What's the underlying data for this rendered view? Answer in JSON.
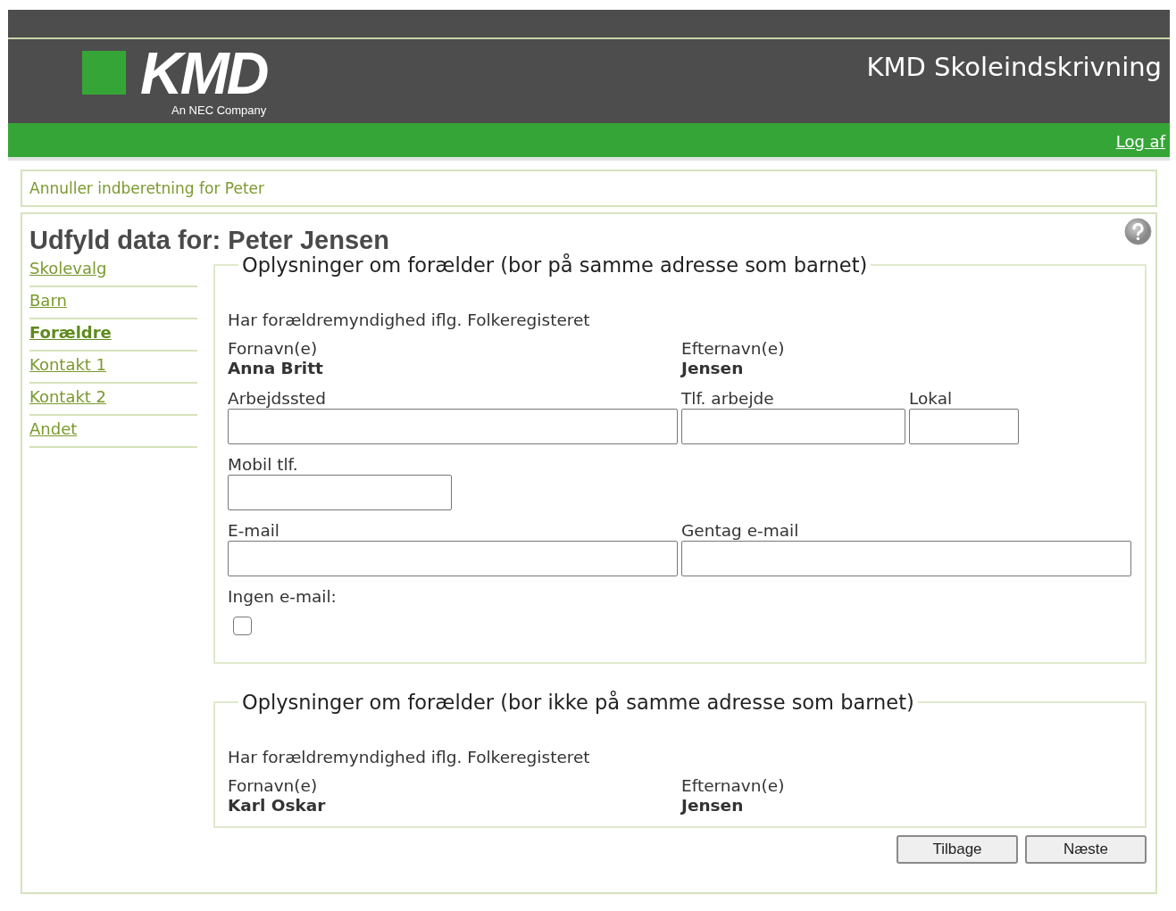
{
  "header": {
    "logo": {
      "wordmark": "KMD",
      "tagline": "An NEC Company"
    },
    "app_title": "KMD Skoleindskrivning",
    "logout_link": "Log af"
  },
  "cancel_link": "Annuller indberetning for Peter",
  "heading": "Udfyld data for: Peter Jensen",
  "nav": [
    {
      "label": "Skolevalg",
      "selected": false
    },
    {
      "label": "Barn",
      "selected": false
    },
    {
      "label": "Forældre",
      "selected": true
    },
    {
      "label": "Kontakt 1",
      "selected": false
    },
    {
      "label": "Kontakt 2",
      "selected": false
    },
    {
      "label": "Andet",
      "selected": false
    }
  ],
  "sections": [
    {
      "legend": "Oplysninger om forælder (bor på samme adresse som barnet)",
      "note": "Har forældremyndighed iflg. Folkeregisteret",
      "names": [
        {
          "label": "Fornavn(e)",
          "value": "Anna Britt"
        },
        {
          "label": "Efternavn(e)",
          "value": "Jensen"
        }
      ],
      "field_rows": [
        [
          {
            "label": "Arbejdssted",
            "kind": "wide"
          },
          {
            "label": "Tlf. arbejde",
            "kind": "medium"
          },
          {
            "label": "Lokal",
            "kind": "small"
          }
        ],
        [
          {
            "label": "Mobil tlf.",
            "kind": "medium"
          }
        ],
        [
          {
            "label": "E-mail",
            "kind": "wide"
          },
          {
            "label": "Gentag e-mail",
            "kind": "wide"
          }
        ]
      ],
      "checkbox": {
        "label": "Ingen e-mail:",
        "checked": false
      }
    },
    {
      "legend": "Oplysninger om forælder (bor ikke på samme adresse som barnet)",
      "note": "Har forældremyndighed iflg. Folkeregisteret",
      "names": [
        {
          "label": "Fornavn(e)",
          "value": "Karl Oskar"
        },
        {
          "label": "Efternavn(e)",
          "value": "Jensen"
        }
      ]
    }
  ],
  "buttons": [
    "Tilbage",
    "Næste"
  ]
}
